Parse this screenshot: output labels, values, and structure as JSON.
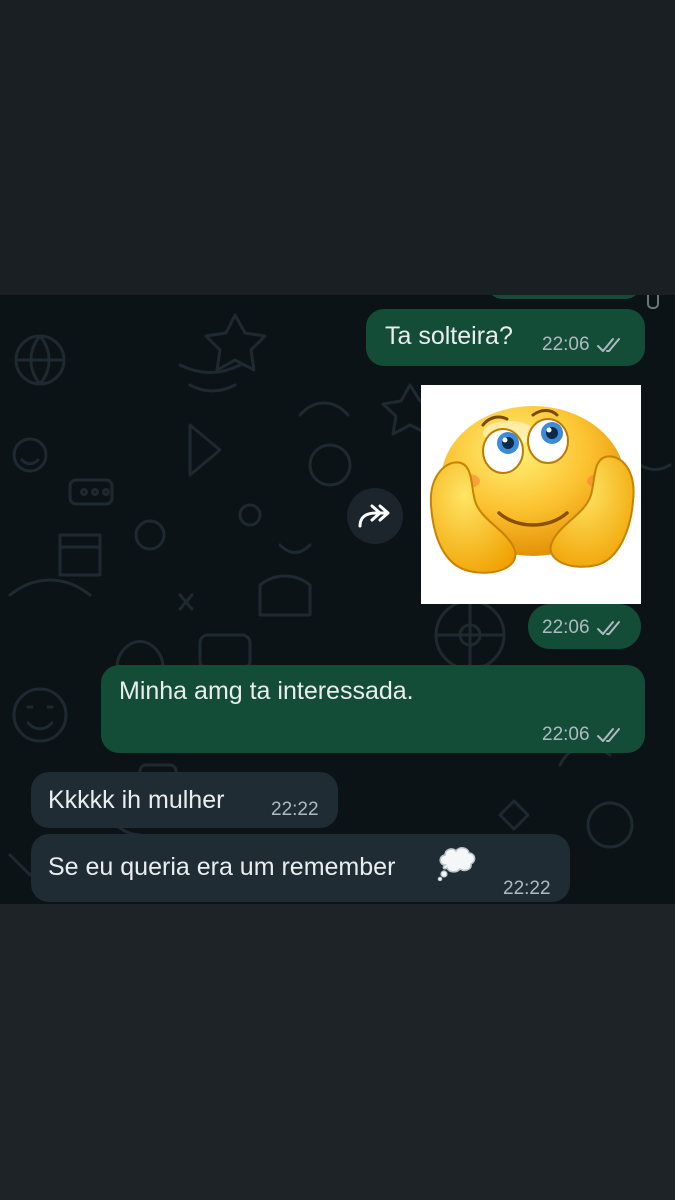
{
  "colors": {
    "outgoing_bubble": "#144d37",
    "incoming_bubble": "#1f2c34",
    "chat_background": "#0c1317",
    "text": "#e9edef",
    "meta_text": "#aebac1"
  },
  "messages": [
    {
      "direction": "outgoing",
      "text": "Ta solteira?",
      "time": "22:06",
      "status": "read-double-check-icon"
    },
    {
      "direction": "outgoing",
      "type": "sticker",
      "sticker": "daydreaming-smiley-emoji",
      "time": "22:06",
      "status": "read-double-check-icon"
    },
    {
      "direction": "outgoing",
      "text": "Minha amg ta interessada.",
      "time": "22:06",
      "status": "read-double-check-icon"
    },
    {
      "direction": "incoming",
      "text": "Kkkkk ih mulher",
      "time": "22:22"
    },
    {
      "direction": "incoming",
      "text": "Se eu queria era um remember",
      "emoji": "thought-balloon-icon",
      "time": "22:22"
    }
  ]
}
